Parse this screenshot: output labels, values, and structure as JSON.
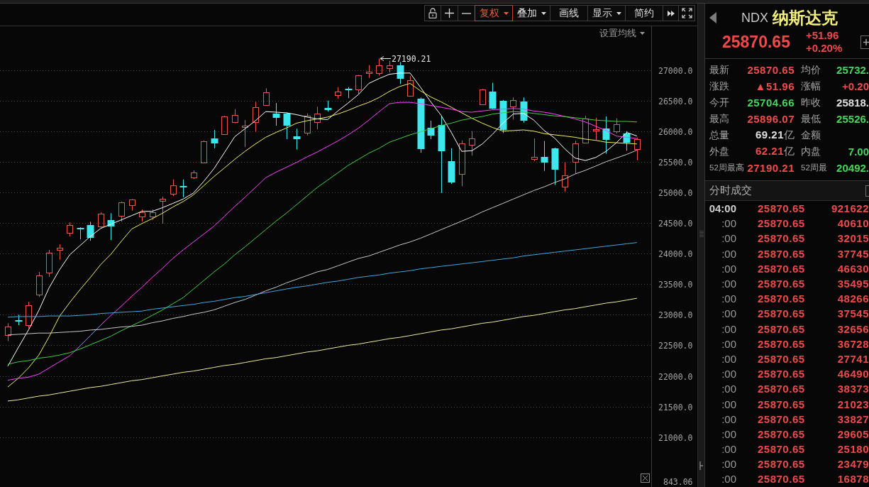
{
  "toolbar": {
    "buttons": [
      {
        "label": "复权",
        "dropdown": true,
        "selected": true
      },
      {
        "label": "叠加",
        "dropdown": true,
        "selected": false
      },
      {
        "label": "画线",
        "dropdown": false,
        "selected": false
      },
      {
        "label": "显示",
        "dropdown": true,
        "selected": false
      },
      {
        "label": "简约",
        "dropdown": false,
        "selected": false
      }
    ]
  },
  "chart": {
    "ma_settings": {
      "label": "设置均线"
    },
    "chart_data": [
      {
        "type": "candlestick",
        "categories": [
          null,
          null,
          null,
          null,
          null,
          null,
          null,
          null,
          null,
          null,
          null,
          null,
          null,
          null,
          null,
          null,
          null,
          null,
          null,
          null,
          null,
          null,
          null,
          null,
          null,
          null,
          null,
          null,
          null,
          null,
          null,
          null,
          null,
          null,
          null,
          null,
          null,
          null,
          null,
          null,
          null,
          null,
          null,
          null,
          null,
          null,
          null,
          null,
          null,
          null,
          null,
          null,
          null,
          null,
          null,
          null,
          null,
          null,
          null,
          null,
          null,
          null
        ],
        "ylim": [
          20185,
          27714
        ],
        "yticks": [
          {
            "value": 21000,
            "label": "21000.0"
          },
          {
            "value": 21500,
            "label": "21500.0"
          },
          {
            "value": 22000,
            "label": "22000.0"
          },
          {
            "value": 22500,
            "label": "22500.0"
          },
          {
            "value": 23000,
            "label": "23000.0"
          },
          {
            "value": 23500,
            "label": "23500.0"
          },
          {
            "value": 24000,
            "label": "24000.0"
          },
          {
            "value": 24500,
            "label": "24500.0"
          },
          {
            "value": 25000,
            "label": "25000.0"
          },
          {
            "value": 25500,
            "label": "25500.0"
          },
          {
            "value": 26000,
            "label": "26000.0"
          },
          {
            "value": 26500,
            "label": "26500.0"
          },
          {
            "value": 27000,
            "label": "27000.0"
          }
        ],
        "grid": true,
        "ohlc": [
          [
            22670,
            22860,
            22570,
            22810
          ],
          [
            22910,
            23000,
            22830,
            22890
          ],
          [
            22830,
            23210,
            22780,
            23155
          ],
          [
            23330,
            23700,
            23290,
            23640
          ],
          [
            23680,
            24060,
            23620,
            24010
          ],
          [
            24050,
            24150,
            23900,
            24090
          ],
          [
            24340,
            24510,
            24280,
            24470
          ],
          [
            24420,
            24430,
            24230,
            24400
          ],
          [
            24470,
            24520,
            24210,
            24260
          ],
          [
            24440,
            24670,
            24420,
            24650
          ],
          [
            24550,
            24660,
            24220,
            24440
          ],
          [
            24620,
            24850,
            24520,
            24840
          ],
          [
            24790,
            24890,
            24700,
            24880
          ],
          [
            24610,
            24720,
            24520,
            24680
          ],
          [
            24610,
            24720,
            24550,
            24680
          ],
          [
            24860,
            24930,
            24490,
            24890
          ],
          [
            24980,
            25210,
            24940,
            25120
          ],
          [
            25100,
            25210,
            24920,
            25080
          ],
          [
            25240,
            25360,
            25220,
            25320
          ],
          [
            25490,
            25850,
            25480,
            25840
          ],
          [
            25880,
            26020,
            25720,
            25800
          ],
          [
            25950,
            26250,
            25940,
            26240
          ],
          [
            26140,
            26360,
            26130,
            26260
          ],
          [
            26070,
            26180,
            25740,
            26090
          ],
          [
            26150,
            26480,
            25990,
            26390
          ],
          [
            26430,
            26700,
            26420,
            26640
          ],
          [
            26290,
            26460,
            26090,
            26220
          ],
          [
            26290,
            26310,
            25870,
            26090
          ],
          [
            25920,
            26040,
            25700,
            25870
          ],
          [
            25970,
            26290,
            25930,
            26250
          ],
          [
            26150,
            26400,
            26030,
            26290
          ],
          [
            26380,
            26500,
            26320,
            26350
          ],
          [
            26590,
            26720,
            26530,
            26650
          ],
          [
            26690,
            26720,
            26540,
            26670
          ],
          [
            26680,
            26920,
            26600,
            26910
          ],
          [
            26950,
            27080,
            26870,
            26970
          ],
          [
            26950,
            27190.21,
            26910,
            27080
          ],
          [
            27030,
            27150,
            26960,
            27080
          ],
          [
            27080,
            27130,
            26770,
            26860
          ],
          [
            26580,
            26900,
            26570,
            26830
          ],
          [
            26530,
            26550,
            25650,
            25710
          ],
          [
            26060,
            26170,
            25870,
            25930
          ],
          [
            26100,
            26240,
            24990,
            25670
          ],
          [
            25510,
            25720,
            25140,
            25160
          ],
          [
            25300,
            25850,
            25100,
            25800
          ],
          [
            25780,
            26000,
            25600,
            25880
          ],
          [
            26440,
            26690,
            26430,
            26680
          ],
          [
            26650,
            26790,
            26360,
            26370
          ],
          [
            26500,
            26510,
            25970,
            26020
          ],
          [
            26400,
            26550,
            26190,
            26510
          ],
          [
            26480,
            26550,
            26140,
            26170
          ],
          [
            25550,
            25880,
            25510,
            25580
          ],
          [
            25580,
            25840,
            25350,
            25490
          ],
          [
            25720,
            25730,
            25120,
            25370
          ],
          [
            25100,
            25490,
            25010,
            25280
          ],
          [
            25500,
            25840,
            25300,
            25800
          ],
          [
            25820,
            26250,
            25810,
            26210
          ],
          [
            26010,
            26220,
            25860,
            26030
          ],
          [
            26040,
            26240,
            25630,
            25850
          ],
          [
            25990,
            26210,
            25960,
            26110
          ],
          [
            25960,
            26000,
            25680,
            25810
          ],
          [
            25704.66,
            25896.07,
            25526.4,
            25870.65
          ]
        ],
        "series": [
          {
            "type": "line",
            "color": "#ffffff",
            "values": [
              22160,
              22460,
              22750,
              23070,
              23440,
              23730,
              23980,
              24130,
              24280,
              24410,
              24480,
              24550,
              24620,
              24690,
              24690,
              24750,
              24820,
              24890,
              24990,
              25180,
              25390,
              25650,
              25910,
              26040,
              26170,
              26320,
              26310,
              26300,
              26270,
              26230,
              26200,
              26190,
              26330,
              26460,
              26600,
              26780,
              26860,
              26930,
              26950,
              26950,
              26720,
              26480,
              26260,
              25980,
              25670,
              25680,
              25790,
              25950,
              26130,
              26280,
              26290,
              26180,
              26010,
              25890,
              25710,
              25560,
              25520,
              25570,
              25670,
              25810,
              25980,
              25920
            ]
          },
          {
            "type": "line",
            "color": "#f0f060",
            "values": [
              21820,
              21960,
              22130,
              22340,
              22640,
              22970,
              23200,
              23410,
              23610,
              23820,
              23990,
              24200,
              24400,
              24490,
              24570,
              24660,
              24760,
              24850,
              24960,
              25110,
              25260,
              25400,
              25540,
              25670,
              25790,
              25900,
              25980,
              26050,
              26130,
              26170,
              26200,
              26230,
              26280,
              26340,
              26410,
              26470,
              26550,
              26650,
              26730,
              26780,
              26660,
              26560,
              26480,
              26390,
              26300,
              26210,
              26130,
              26060,
              26000,
              26010,
              26020,
              26000,
              25960,
              25940,
              25920,
              25900,
              25870,
              25850,
              25820,
              25810,
              25800,
              25790
            ]
          },
          {
            "type": "line",
            "color": "#ff40ff",
            "values": [
              21930,
              21960,
              21980,
              22030,
              22130,
              22230,
              22330,
              22490,
              22660,
              22830,
              22990,
              23140,
              23300,
              23450,
              23610,
              23760,
              23920,
              24060,
              24190,
              24320,
              24450,
              24610,
              24770,
              24920,
              25080,
              25240,
              25330,
              25410,
              25490,
              25580,
              25660,
              25750,
              25840,
              25940,
              26050,
              26180,
              26320,
              26450,
              26470,
              26470,
              26450,
              26420,
              26390,
              26360,
              26320,
              26310,
              26330,
              26350,
              26360,
              26370,
              26360,
              26330,
              26310,
              26280,
              26240,
              26200,
              26150,
              26080,
              26010,
              25920,
              25900,
              25880
            ]
          },
          {
            "type": "line",
            "color": "#40d040",
            "values": [
              22190,
              22230,
              22250,
              22290,
              22310,
              22340,
              22380,
              22440,
              22510,
              22580,
              22650,
              22740,
              22820,
              22900,
              22990,
              23080,
              23180,
              23280,
              23420,
              23560,
              23700,
              23830,
              23980,
              24110,
              24250,
              24390,
              24530,
              24660,
              24800,
              24940,
              25080,
              25200,
              25320,
              25440,
              25540,
              25640,
              25720,
              25820,
              25880,
              25940,
              25990,
              26040,
              26090,
              26130,
              26180,
              26210,
              26240,
              26280,
              26300,
              26320,
              26310,
              26290,
              26270,
              26250,
              26240,
              26220,
              26200,
              26180,
              26170,
              26160,
              26160,
              26150
            ]
          },
          {
            "type": "line",
            "color": "#c8c8c8",
            "values": [
              22670,
              22680,
              22690,
              22700,
              22700,
              22710,
              22720,
              22730,
              22750,
              22760,
              22780,
              22800,
              22810,
              22830,
              22870,
              22900,
              22940,
              22970,
              23010,
              23040,
              23080,
              23140,
              23200,
              23250,
              23320,
              23390,
              23450,
              23520,
              23580,
              23640,
              23700,
              23740,
              23800,
              23860,
              23920,
              23960,
              24020,
              24080,
              24140,
              24190,
              24250,
              24320,
              24390,
              24460,
              24530,
              24600,
              24680,
              24750,
              24820,
              24890,
              24960,
              25030,
              25090,
              25160,
              25220,
              25300,
              25360,
              25430,
              25500,
              25560,
              25620,
              25690
            ]
          },
          {
            "type": "line",
            "color": "#40a8e0",
            "values": [
              22960,
              22970,
              22970,
              22970,
              22980,
              22980,
              22980,
              22990,
              23000,
              23020,
              23030,
              23040,
              23050,
              23060,
              23090,
              23110,
              23130,
              23150,
              23170,
              23200,
              23220,
              23250,
              23280,
              23300,
              23330,
              23360,
              23390,
              23420,
              23450,
              23470,
              23500,
              23530,
              23550,
              23580,
              23610,
              23630,
              23650,
              23680,
              23700,
              23720,
              23750,
              23770,
              23790,
              23810,
              23830,
              23850,
              23870,
              23890,
              23910,
              23930,
              23960,
              23980,
              24000,
              24020,
              24040,
              24060,
              24080,
              24100,
              24120,
              24140,
              24160,
              24180
            ]
          },
          {
            "type": "line",
            "color": "#ecec9e",
            "values": [
              21590,
              21610,
              21640,
              21670,
              21690,
              21720,
              21750,
              21780,
              21810,
              21830,
              21860,
              21890,
              21920,
              21940,
              21970,
              22000,
              22030,
              22060,
              22080,
              22110,
              22140,
              22170,
              22190,
              22220,
              22250,
              22280,
              22300,
              22330,
              22360,
              22390,
              22410,
              22440,
              22470,
              22500,
              22520,
              22550,
              22580,
              22610,
              22630,
              22660,
              22690,
              22720,
              22750,
              22770,
              22800,
              22830,
              22860,
              22880,
              22910,
              22940,
              22970,
              22990,
              23020,
              23050,
              23080,
              23100,
              23130,
              23160,
              23190,
              23210,
              23240,
              23270
            ]
          }
        ],
        "annotations": [
          "27190.21"
        ]
      }
    ],
    "lower_pane": {
      "axis_label": "843.06"
    }
  },
  "quote": {
    "symbol": "NDX",
    "name": "纳斯达克",
    "price": "25870.65",
    "change": "+51.96",
    "change_pct": "+0.20%",
    "rows": [
      {
        "kind": "normal",
        "cells": [
          {
            "label": "最新",
            "value": "25870.65",
            "color": "#f04b4b"
          },
          {
            "label": "均价",
            "value": "25732.",
            "color": "#44d65a"
          }
        ]
      },
      {
        "kind": "normal",
        "cells": [
          {
            "label": "涨跌",
            "value": "▲51.96",
            "color": "#f04b4b"
          },
          {
            "label": "涨幅",
            "value": "+0.20",
            "color": "#f04b4b"
          }
        ]
      },
      {
        "kind": "normal",
        "cells": [
          {
            "label": "今开",
            "value": "25704.66",
            "color": "#44d65a"
          },
          {
            "label": "昨收",
            "value": "25818.",
            "color": "#e0e0e0"
          }
        ]
      },
      {
        "kind": "normal",
        "cells": [
          {
            "label": "最高",
            "value": "25896.07",
            "color": "#f04b4b"
          },
          {
            "label": "最低",
            "value": "25526.",
            "color": "#44d65a"
          }
        ]
      },
      {
        "kind": "normal",
        "cells": [
          {
            "label": "总量",
            "value": "69.21",
            "unit": "亿",
            "color": "#e0e0e0"
          },
          {
            "label": "金额"
          }
        ]
      },
      {
        "kind": "normal",
        "cells": [
          {
            "label": "外盘",
            "value": "62.21",
            "unit": "亿",
            "color": "#f04b4b"
          },
          {
            "label": "内盘",
            "value": "7.00",
            "color": "#44d65a"
          }
        ]
      },
      {
        "kind": "compact",
        "cells": [
          {
            "label": "52周最高",
            "value": "27190.21",
            "color": "#f04b4b"
          },
          {
            "label": "52周最",
            "value": "20492.",
            "color": "#44d65a"
          }
        ]
      }
    ]
  },
  "trades": {
    "title": "分时成交",
    "rows": [
      {
        "kind": "hour",
        "time": "04:00",
        "price": "25870.65",
        "volume": "921622"
      },
      {
        "kind": "minute",
        "time": ":00",
        "price": "25870.65",
        "volume": "40610"
      },
      {
        "kind": "minute",
        "time": ":00",
        "price": "25870.65",
        "volume": "32015"
      },
      {
        "kind": "minute",
        "time": ":00",
        "price": "25870.65",
        "volume": "37745"
      },
      {
        "kind": "minute",
        "time": ":00",
        "price": "25870.65",
        "volume": "46630"
      },
      {
        "kind": "minute",
        "time": ":00",
        "price": "25870.65",
        "volume": "35495"
      },
      {
        "kind": "minute",
        "time": ":00",
        "price": "25870.65",
        "volume": "48266"
      },
      {
        "kind": "minute",
        "time": ":00",
        "price": "25870.65",
        "volume": "37545"
      },
      {
        "kind": "minute",
        "time": ":00",
        "price": "25870.65",
        "volume": "32656"
      },
      {
        "kind": "minute",
        "time": ":00",
        "price": "25870.65",
        "volume": "36728"
      },
      {
        "kind": "minute",
        "time": ":00",
        "price": "25870.65",
        "volume": "27741"
      },
      {
        "kind": "minute",
        "time": ":00",
        "price": "25870.65",
        "volume": "46490"
      },
      {
        "kind": "minute",
        "time": ":00",
        "price": "25870.65",
        "volume": "38373"
      },
      {
        "kind": "minute",
        "time": ":00",
        "price": "25870.65",
        "volume": "21023"
      },
      {
        "kind": "minute",
        "time": ":00",
        "price": "25870.65",
        "volume": "33827"
      },
      {
        "kind": "minute",
        "time": ":00",
        "price": "25870.65",
        "volume": "29605"
      },
      {
        "kind": "minute",
        "time": ":00",
        "price": "25870.65",
        "volume": "25180"
      },
      {
        "kind": "minute",
        "time": ":00",
        "price": "25870.65",
        "volume": "23479"
      },
      {
        "kind": "minute",
        "time": ":00",
        "price": "25870.65",
        "volume": "16878"
      }
    ]
  }
}
